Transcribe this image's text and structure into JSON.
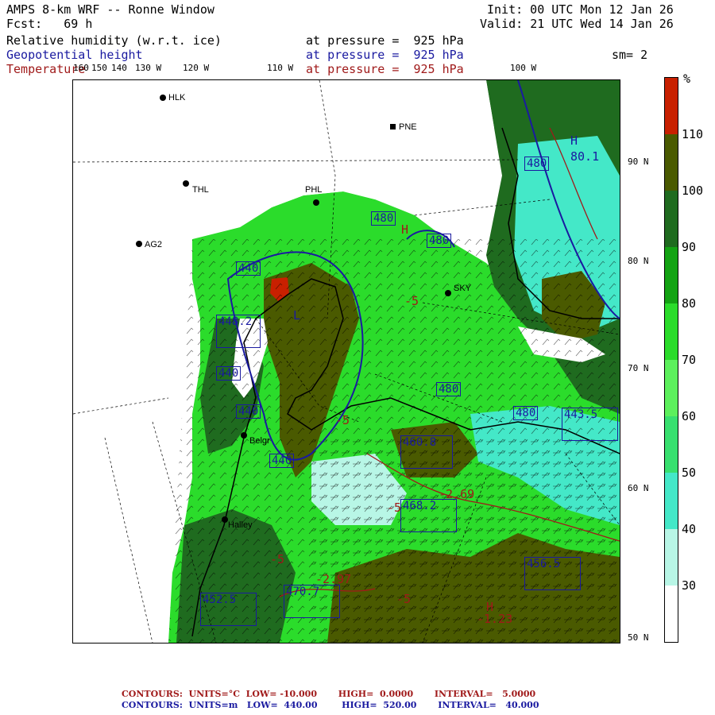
{
  "header": {
    "title": "AMPS 8-km WRF -- Ronne Window",
    "init": "Init: 00 UTC Mon 12 Jan 26",
    "fcst": "Fcst:   69 h",
    "valid": "Valid: 21 UTC Wed 14 Jan 26",
    "fields": [
      {
        "name": "Relative humidity (w.r.t. ice)",
        "level": "at pressure =  925 hPa",
        "color": "#000000"
      },
      {
        "name": "Geopotential height",
        "level": "at pressure =  925 hPa",
        "color": "#1a1aa0"
      },
      {
        "name": "Temperature",
        "level": "at pressure =  925 hPa",
        "color": "#a01a1a"
      }
    ],
    "smoothing": "sm= 2"
  },
  "longitudes": [
    "160",
    "150",
    "140",
    "130 W",
    "120 W",
    "110 W",
    "100 W"
  ],
  "latitudes": [
    "90 N",
    "80 N",
    "70 N",
    "60 N",
    "50 N"
  ],
  "colorbar": {
    "unit": "%",
    "labels": [
      "110",
      "100",
      "90",
      "80",
      "70",
      "60",
      "50",
      "40",
      "30"
    ],
    "colors": [
      "#c82000",
      "#4a5a00",
      "#1f6b1f",
      "#13a313",
      "#2bdc2b",
      "#5cf05c",
      "#38e06f",
      "#44e8c8",
      "#b8f6e6",
      "#ffffff"
    ]
  },
  "stations": [
    {
      "id": "HLK"
    },
    {
      "id": "PNE"
    },
    {
      "id": "THL"
    },
    {
      "id": "PHL"
    },
    {
      "id": "AG2"
    },
    {
      "id": "SKY"
    },
    {
      "id": "Belgr"
    },
    {
      "id": "Halley"
    }
  ],
  "height_boxes": [
    {
      "text": "480"
    },
    {
      "text": "480"
    },
    {
      "text": "440"
    },
    {
      "text": "448.2"
    },
    {
      "text": "440"
    },
    {
      "text": "440"
    },
    {
      "text": "440"
    },
    {
      "text": "460.8"
    },
    {
      "text": "468.2"
    },
    {
      "text": "470.7"
    },
    {
      "text": "452.5"
    },
    {
      "text": "456.5"
    },
    {
      "text": "443.5"
    },
    {
      "text": "480"
    },
    {
      "text": "480"
    },
    {
      "text": "480"
    }
  ],
  "markers": {
    "L": "L",
    "H": "H",
    "temps": [
      "-5",
      "-2.69",
      "-5",
      "-5",
      "-5",
      "-2.97",
      "-1.23",
      "-5"
    ],
    "hl_labels": [
      "80.1"
    ]
  },
  "footer": {
    "line1": "CONTOURS:  UNITS=°C  LOW= -10.000       HIGH=  0.0000       INTERVAL=   5.0000",
    "line2": "CONTOURS:  UNITS=m   LOW=  440.00        HIGH=  520.00       INTERVAL=   40.000"
  }
}
